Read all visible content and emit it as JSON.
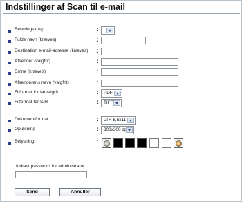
{
  "page": {
    "title": "Indstillinger af Scan til e-mail"
  },
  "form": {
    "rows": [
      {
        "label": "Berøringsknap",
        "type": "select",
        "value": ""
      },
      {
        "label": "Fulde navn (kræves)",
        "type": "text",
        "value": ""
      },
      {
        "label": "Destination e-mail-adresse (kræves)",
        "type": "text",
        "value": ""
      },
      {
        "label": "Afsender (valgfrit)",
        "type": "text",
        "value": ""
      },
      {
        "label": "Emne (kræves)",
        "type": "text",
        "value": ""
      },
      {
        "label": "Afsenderens navn (valgfrit)",
        "type": "text",
        "value": ""
      },
      {
        "label": "Filformat for farve/grå",
        "type": "select",
        "value": "PDF"
      },
      {
        "label": "Filformat for S/H",
        "type": "select",
        "value": "TIFF"
      },
      {
        "label": "Dokumentformat",
        "type": "select",
        "value": "LTR 8,5x11"
      },
      {
        "label": "Opløsning",
        "type": "select",
        "value": "300x300 dpi"
      },
      {
        "label": "Belysning",
        "type": "brightness",
        "value": ""
      }
    ],
    "colon": ":",
    "brightness": {
      "decrease_icon": "brightness-decrease-icon",
      "increase_icon": "brightness-increase-icon",
      "levels": [
        "dark",
        "dark",
        "dark",
        "light",
        "light"
      ]
    }
  },
  "admin": {
    "label": "Indtast password for administrator",
    "value": ""
  },
  "buttons": {
    "send": "Send",
    "cancel": "Annullér"
  },
  "colors": {
    "bullet": "#2b3f8c",
    "rule": "#98a6b2",
    "border": "#b9c3cc"
  }
}
